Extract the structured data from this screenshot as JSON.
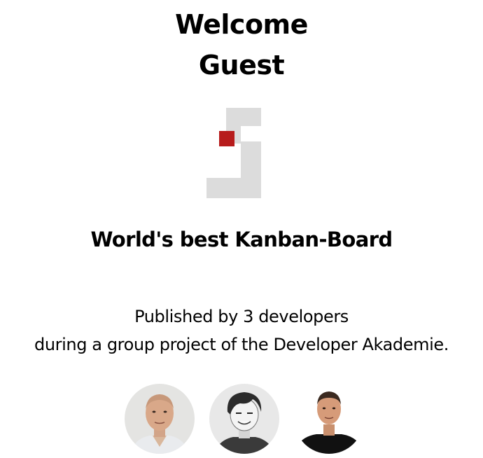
{
  "welcome": {
    "line1": "Welcome",
    "line2": "Guest"
  },
  "logo": {
    "icon": "join-logo-icon",
    "accent_color": "#b71c1c",
    "gray_color": "#dcdcdc"
  },
  "tagline": "World's best Kanban-Board",
  "published": {
    "line1": "Published by 3 developers",
    "line2": "during a group project of the Developer Akademie."
  },
  "developers": [
    {
      "avatar": "developer-1-avatar"
    },
    {
      "avatar": "developer-2-avatar"
    },
    {
      "avatar": "developer-3-avatar"
    }
  ]
}
